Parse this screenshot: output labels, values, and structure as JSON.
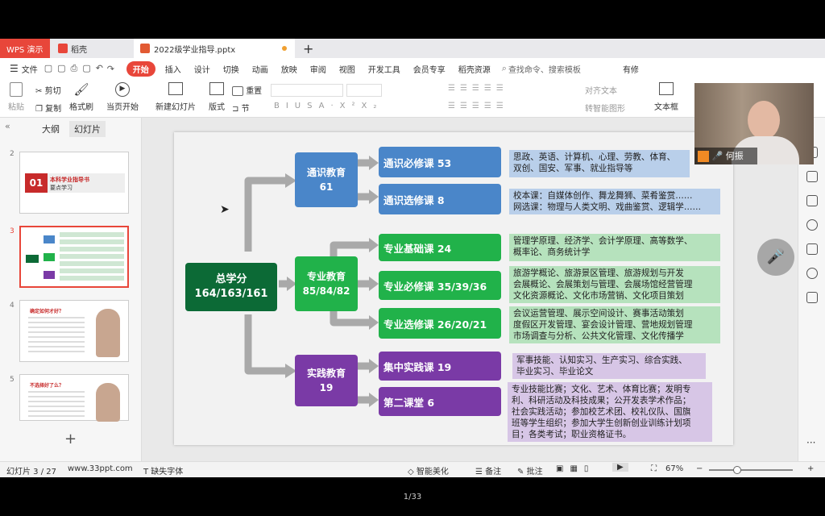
{
  "tabs": {
    "wps": "WPS 演示",
    "daoke": "稻壳",
    "file": "2022级学业指导.pptx",
    "plus": "+"
  },
  "menu": {
    "items": [
      "文件",
      "开始",
      "插入",
      "设计",
      "切换",
      "动画",
      "放映",
      "审阅",
      "视图",
      "开发工具",
      "会员专享",
      "稻壳资源"
    ],
    "search": "查找命令、搜索模板",
    "share": "有修"
  },
  "ribbon": {
    "paste": "粘贴",
    "cut": "剪切",
    "copy": "复制",
    "format_brush": "格式刷",
    "play": "当页开始",
    "new_slide": "新建幻灯片",
    "layout": "版式",
    "section": "节",
    "reset": "重置",
    "align_text": "对齐文本",
    "smart_shape": "转智能图形",
    "textbox": "文本框"
  },
  "leftpane": {
    "tab_outline": "大纲",
    "tab_slides": "幻灯片",
    "numbers": [
      "2",
      "3",
      "4",
      "5"
    ],
    "thumb2_num": "01",
    "thumb2_title": "本科学业指导书",
    "thumb2_sub": "要点学习",
    "thumb4_title": "确定如何才好？",
    "thumb5_title": "不选择好了么？"
  },
  "slide": {
    "total": {
      "label": "总学分",
      "value": "164/163/161"
    },
    "groups": [
      {
        "label": "通识教育",
        "value": "61"
      },
      {
        "label": "专业教育",
        "value": "85/84/82"
      },
      {
        "label": "实践教育",
        "value": "19"
      }
    ],
    "courses": [
      {
        "label": "通识必修课  53",
        "desc": [
          "思政、英语、计算机、心理、劳教、体育、",
          "双创、国安、军事、就业指导等"
        ]
      },
      {
        "label": "通识选修课  8",
        "desc": [
          "校本课：自媒体创作、舞龙舞狮、菜肴鉴赏……",
          "网选课：物理与人类文明、戏曲鉴赏、逻辑学……"
        ]
      },
      {
        "label": "专业基础课  24",
        "desc": [
          "管理学原理、经济学、会计学原理、高等数学、",
          "概率论、商务统计学"
        ]
      },
      {
        "label": "专业必修课  35/39/36",
        "desc": [
          "旅游学概论、旅游景区管理、旅游规划与开发",
          "会展概论、会展策划与管理、会展场馆经营管理",
          "文化资源概论、文化市场营销、文化项目策划"
        ]
      },
      {
        "label": "专业选修课  26/20/21",
        "desc": [
          "会议运营管理、展示空间设计、赛事活动策划",
          "度假区开发管理、宴会设计管理、营地规划管理",
          "市场调查与分析、公共文化管理、文化传播学"
        ]
      },
      {
        "label": "集中实践课  19",
        "desc": [
          "军事技能、认知实习、生产实习、综合实践、",
          "毕业实习、毕业论文"
        ]
      },
      {
        "label": "第二课堂      6",
        "desc": [
          "专业技能比赛；文化、艺术、体育比赛；发明专",
          "利、科研活动及科技成果；公开发表学术作品；",
          "社会实践活动；参加校艺术团、校礼仪队、国旗",
          "班等学生组织；参加大学生创新创业训练计划项",
          "目；各类考试；职业资格证书。"
        ]
      }
    ]
  },
  "status": {
    "slide_no": "幻灯片 3 / 27",
    "site": "www.33ppt.com",
    "missing_font": "缺失字体",
    "beautify": "智能美化",
    "notes": "备注",
    "comment": "批注",
    "zoom": "67%"
  },
  "video": {
    "name": "何振"
  },
  "page_indicator": "1/33",
  "colors": {
    "wps_red": "#e8463a",
    "blue": "#4a86c9",
    "green": "#21b24a",
    "purple": "#7a3aa6",
    "dark_green": "#0c6a36"
  }
}
